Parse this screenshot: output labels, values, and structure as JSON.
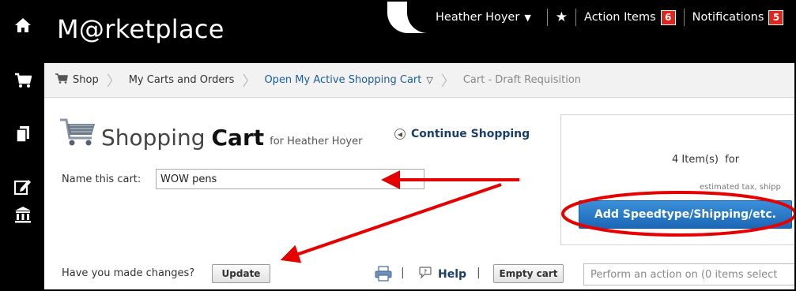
{
  "app": {
    "brand": "M@rketplace"
  },
  "left_nav": [
    {
      "icon": "home-icon"
    },
    {
      "icon": "cart-icon"
    },
    {
      "icon": "documents-icon"
    },
    {
      "icon": "edit-icon"
    },
    {
      "icon": "institution-icon"
    }
  ],
  "user_bar": {
    "user_name": "Heather Hoyer",
    "action_items_label": "Action Items",
    "action_items_count": "6",
    "notifications_label": "Notifications",
    "notifications_count": "5"
  },
  "breadcrumb": {
    "shop": "Shop",
    "my_carts": "My Carts and Orders",
    "active_cart": "Open My Active Shopping Cart",
    "current": "Cart - Draft Requisition"
  },
  "cart": {
    "title_light": "Shopping",
    "title_bold": "Cart",
    "for_text": "for Heather Hoyer",
    "continue_label": "Continue Shopping",
    "name_label": "Name this cart:",
    "name_value": "WOW pens"
  },
  "summary": {
    "items_text": "4 Item(s)  for",
    "tax_text": "estimated tax, shipp",
    "add_button": "Add Speedtype/Shipping/etc."
  },
  "bottom": {
    "changes_label": "Have you made changes?",
    "update_button": "Update",
    "help_label": "Help",
    "empty_cart_button": "Empty cart",
    "action_placeholder": "Perform an action on (0 items select"
  },
  "colors": {
    "header_bg": "#000000",
    "badge": "#e1251b",
    "primary_button": "#1c67b6",
    "annotation": "#e60000"
  }
}
